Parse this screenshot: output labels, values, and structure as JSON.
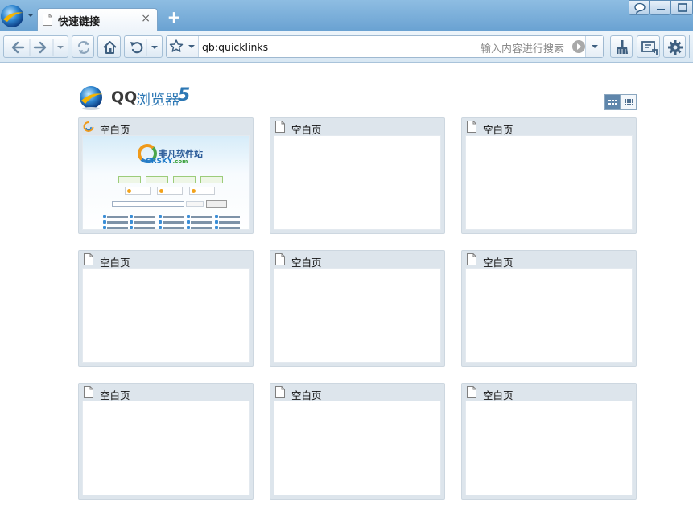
{
  "browser": {
    "tab": {
      "title": "快速链接",
      "close_glyph": "×"
    },
    "new_tab_glyph": "+",
    "address": {
      "url": "qb:quicklinks",
      "search_placeholder": "输入内容进行搜索"
    }
  },
  "brand": {
    "qq": "QQ",
    "name": "浏览器",
    "version": "5"
  },
  "tiles": [
    {
      "title": "空白页",
      "has_thumbnail": true,
      "icon": "crsky-favicon-icon"
    },
    {
      "title": "空白页",
      "icon": "blank-page-icon"
    },
    {
      "title": "空白页",
      "icon": "blank-page-icon"
    },
    {
      "title": "空白页",
      "icon": "blank-page-icon"
    },
    {
      "title": "空白页",
      "icon": "blank-page-icon"
    },
    {
      "title": "空白页",
      "icon": "blank-page-icon"
    },
    {
      "title": "空白页",
      "icon": "blank-page-icon"
    },
    {
      "title": "空白页",
      "icon": "blank-page-icon"
    },
    {
      "title": "空白页",
      "icon": "blank-page-icon"
    }
  ],
  "thumbnail": {
    "site_name_cn": "非凡软件站",
    "site_name_en": "CRSKY",
    "site_domain": ".com"
  },
  "colors": {
    "titlebar": "#7bb0dc",
    "accent": "#2c77b4",
    "tile_frame": "#dde5ec"
  }
}
